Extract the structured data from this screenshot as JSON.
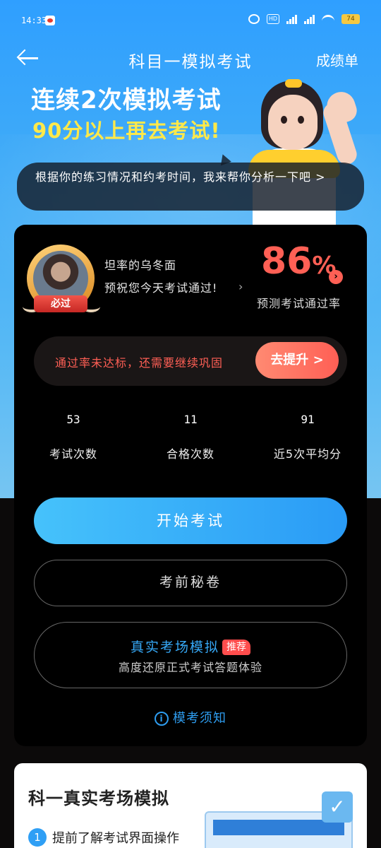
{
  "status_bar": {
    "time": "14:33",
    "battery": "74"
  },
  "nav": {
    "title": "科目一模拟考试",
    "right_action": "成绩单"
  },
  "banner": {
    "line1": "连续2次模拟考试",
    "line2": "90分以上再去考试!"
  },
  "bubble": {
    "text": "根据你的练习情况和约考时间，我来帮你分析一下吧 >"
  },
  "profile": {
    "badge": "必过",
    "name": "坦率的乌冬面",
    "wish": "预祝您今天考试通过!"
  },
  "pass_rate": {
    "value": "86",
    "unit": "%",
    "label": "预测考试通过率"
  },
  "warning": {
    "text": "通过率未达标，还需要继续巩固",
    "button": "去提升 >"
  },
  "stats": [
    {
      "value": "53",
      "label": "考试次数"
    },
    {
      "value": "11",
      "label": "合格次数"
    },
    {
      "value": "91",
      "label": "近5次平均分"
    }
  ],
  "actions": {
    "start": "开始考试",
    "secret": "考前秘卷",
    "real_title": "真实考场模拟",
    "real_tag": "推荐",
    "real_sub": "高度还原正式考试答题体验",
    "notice": "模考须知"
  },
  "bottom_card": {
    "title": "科一真实考场模拟",
    "item_num": "1",
    "item_text": "提前了解考试界面操作"
  },
  "colors": {
    "accent_blue": "#2a9bf6",
    "warn_red": "#ff5f55",
    "tag_red": "#ff4d4d"
  }
}
